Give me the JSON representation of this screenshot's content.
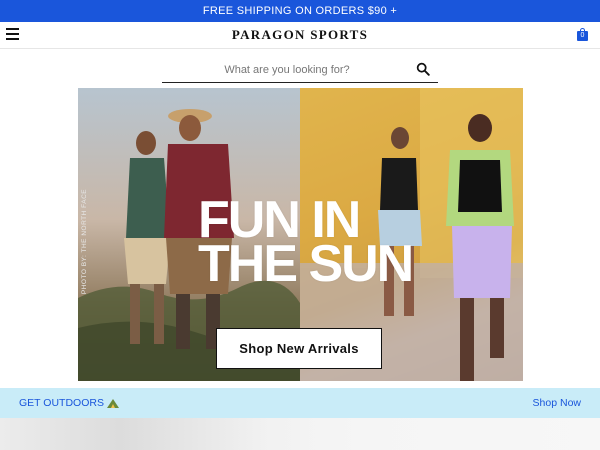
{
  "promo": {
    "text": "FREE SHIPPING ON ORDERS $90 +"
  },
  "header": {
    "logo": "PARAGON SPORTS",
    "cart_count": "0"
  },
  "search": {
    "placeholder": "What are you looking for?"
  },
  "hero": {
    "credit": "PHOTO BY: THE NORTH FACE",
    "headline_line1": "FUN IN",
    "headline_line2": "THE SUN",
    "cta_label": "Shop New Arrivals"
  },
  "outdoors": {
    "label": "GET OUTDOORS",
    "icon": "tent-icon",
    "cta_label": "Shop Now"
  },
  "colors": {
    "brand_blue": "#1a56db",
    "banner_bg": "#c9ecf8"
  }
}
